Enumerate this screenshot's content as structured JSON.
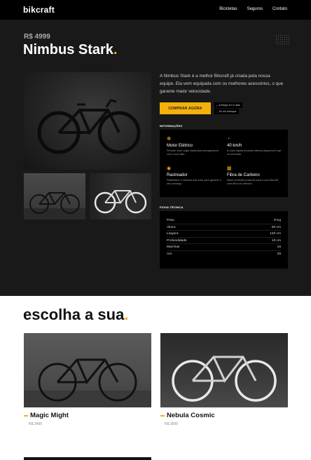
{
  "header": {
    "logo": "bikcraft",
    "nav": [
      "Bicicletas",
      "Seguros",
      "Contato"
    ]
  },
  "product": {
    "price": "R$ 4999",
    "name": "Nimbus Stark",
    "description": "A Nimbus Stark é a melhor Bikcraft já criada pela nossa equipe. Ela vem equipada com os melhores acessórios, o que garante maior velocidade.",
    "buy_label": "COMPRAR AGORA",
    "badges": [
      "entrega em 5 dias",
      "16 em estoque"
    ]
  },
  "info": {
    "label": "INFORMAÇÕES",
    "features": [
      {
        "icon": "bike-icon",
        "title": "Motor Elétrico",
        "text": "Permite você viajar distâncias inimagináveis com a sua bike."
      },
      {
        "icon": "speedometer-icon",
        "title": "40 km/h",
        "text": "A mais rápida bicicleta elétrica disponível hoje no mercado."
      },
      {
        "icon": "location-pin-icon",
        "title": "Rastreador",
        "text": "Rastreador e sistema anti-furto para garantir o seu sossego."
      },
      {
        "icon": "carbon-fiber-icon",
        "title": "Fibra de Carbono",
        "text": "Maior proteção possível para a sua Bikcraft com fibra de carbono."
      }
    ]
  },
  "specs": {
    "label": "FICHA TÉCNICA",
    "rows": [
      {
        "label": "Peso",
        "value": "9 Kg"
      },
      {
        "label": "Altura",
        "value": "60 cm"
      },
      {
        "label": "Largura",
        "value": "120 cm"
      },
      {
        "label": "Profundidade",
        "value": "10 cm"
      },
      {
        "label": "Marchas",
        "value": "16"
      },
      {
        "label": "Aro",
        "value": "29"
      }
    ]
  },
  "choose": {
    "title": "escolha a sua",
    "cards": [
      {
        "name": "Magic Might",
        "price": "R$ 2499"
      },
      {
        "name": "Nebula Cosmic",
        "price": "R$ 3999"
      }
    ]
  },
  "colors": {
    "accent": "#f5b00c",
    "hero_bg": "#191919",
    "box_bg": "#000000"
  }
}
